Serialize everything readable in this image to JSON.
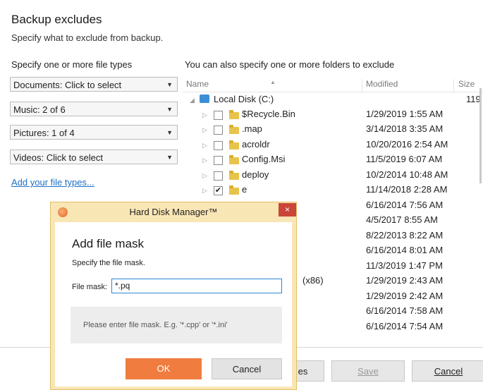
{
  "header": {
    "title": "Backup excludes",
    "subtitle": "Specify what to exclude from backup."
  },
  "left": {
    "heading": "Specify one or more file types",
    "combos": [
      {
        "label": "Documents: Click to select"
      },
      {
        "label": "Music: 2 of 6"
      },
      {
        "label": "Pictures: 1 of 4"
      },
      {
        "label": "Videos: Click to select"
      }
    ],
    "add_link": "Add your file types..."
  },
  "right": {
    "heading": "You can also specify one or more folders to exclude",
    "columns": {
      "name": "Name",
      "modified": "Modified",
      "size": "Size"
    },
    "root": {
      "name": "Local Disk (C:)",
      "size": "119"
    },
    "rows": [
      {
        "name": "$Recycle.Bin",
        "modified": "1/29/2019 1:55 AM",
        "checked": false
      },
      {
        "name": ".map",
        "modified": "3/14/2018 3:35 AM",
        "checked": false
      },
      {
        "name": "acroldr",
        "modified": "10/20/2016 2:54 AM",
        "checked": false
      },
      {
        "name": "Config.Msi",
        "modified": "11/5/2019 6:07 AM",
        "checked": false
      },
      {
        "name": "deploy",
        "modified": "10/2/2014 10:48 AM",
        "checked": false
      },
      {
        "name": "e",
        "modified": "11/14/2018 2:28 AM",
        "checked": true
      }
    ],
    "hidden_rows_modified": [
      "6/16/2014 7:56 AM",
      "4/5/2017 8:55 AM",
      "8/22/2013 8:22 AM",
      "6/16/2014 8:01 AM",
      "11/3/2019 1:47 PM",
      "1/29/2019 2:43 AM",
      "1/29/2019 2:42 AM",
      "6/16/2014 7:58 AM",
      "6/16/2014 7:54 AM"
    ],
    "partial_name_x86": "(x86)"
  },
  "footer": {
    "partial_button": "es",
    "save": "Save",
    "cancel": "Cancel"
  },
  "dialog": {
    "window_title": "Hard Disk Manager™",
    "close": "×",
    "heading": "Add file mask",
    "subheading": "Specify the file mask.",
    "field_label": "File mask:",
    "field_value": "*.pq",
    "hint": "Please enter file mask. E.g. '*.cpp' or '*.ini'",
    "ok": "OK",
    "cancel": "Cancel"
  }
}
